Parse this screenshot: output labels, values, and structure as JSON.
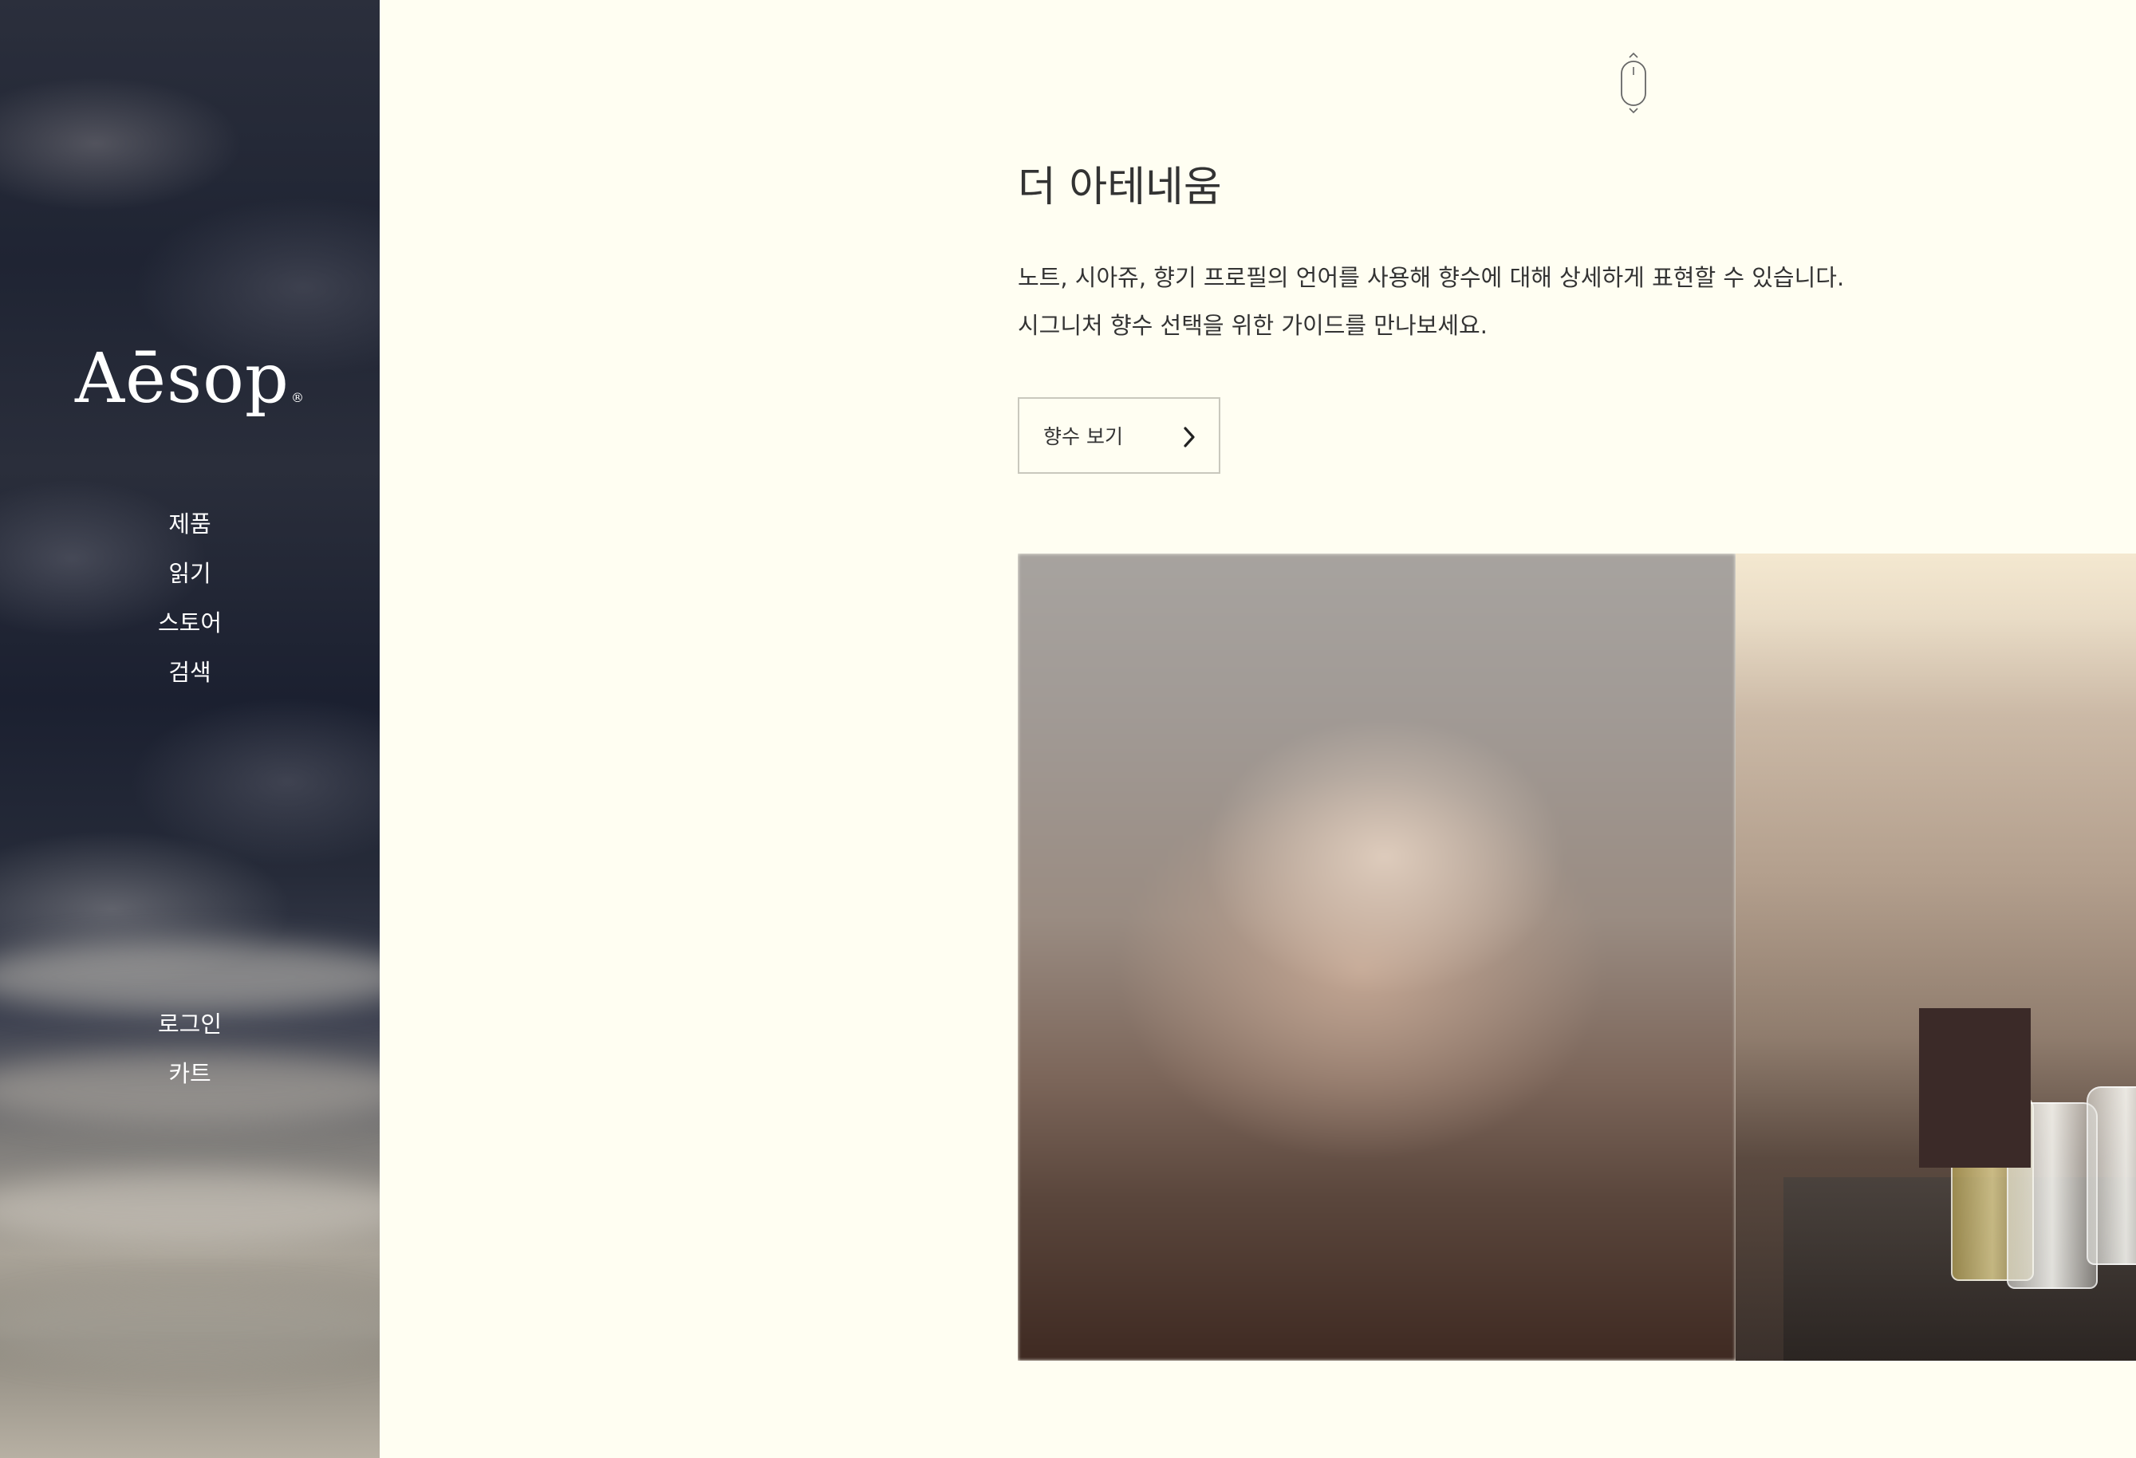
{
  "sidebar": {
    "logo": "Aēsop",
    "logo_mark": "®",
    "nav": [
      {
        "label": "제품"
      },
      {
        "label": "읽기"
      },
      {
        "label": "스토어"
      },
      {
        "label": "검색"
      }
    ],
    "account": [
      {
        "label": "로그인"
      },
      {
        "label": "카트"
      }
    ]
  },
  "main": {
    "heading": "더 아테네움",
    "description": [
      "노트, 시아쥬, 향기 프로필의 언어를 사용해 향수에 대해 상세하게 표현할 수 있습니다.",
      "시그니처 향수 선택을 위한 가이드를 만나보세요."
    ],
    "cta": {
      "label": "향수 보기",
      "icon": "chevron-right-icon"
    },
    "scroll_icon": "mouse-scroll-icon",
    "images": [
      {
        "name": "blurred-rose-image"
      },
      {
        "name": "perfume-studio-image"
      }
    ]
  },
  "colors": {
    "background": "#fffef2",
    "text": "#333333",
    "sidebar_text": "#ffffff",
    "button_border": "#c9c8bd"
  }
}
